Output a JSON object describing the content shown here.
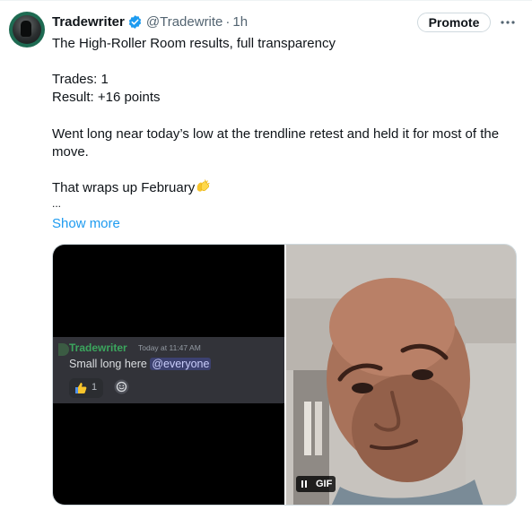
{
  "tweet": {
    "display_name": "Tradewriter",
    "handle": "@Tradewrite",
    "separator": "·",
    "time": "1h",
    "promote_label": "Promote",
    "lines": {
      "line1": "The High-Roller Room results, full transparency",
      "line2": "Trades: 1",
      "line3": "Result: +16 points",
      "line4": "Went long near today’s low at the trendline retest and held it for most of the",
      "line5": "move.",
      "line6": "That wraps up February",
      "line7": "..."
    },
    "emoji": "clapping-hands-icon",
    "show_more": "Show more"
  },
  "media": {
    "discord": {
      "username": "Tradewriter",
      "timestamp": "Today at 11:47 AM",
      "message": "Small long here",
      "mention": "@everyone",
      "reaction_emoji": "thumbs-up-icon",
      "reaction_count": "1"
    },
    "gif_label": "GIF"
  },
  "colors": {
    "accent": "#1d9bf0",
    "verified": "#1d9bf0",
    "discord_username": "#3ba55d",
    "discord_mention_bg": "#3c4170"
  }
}
